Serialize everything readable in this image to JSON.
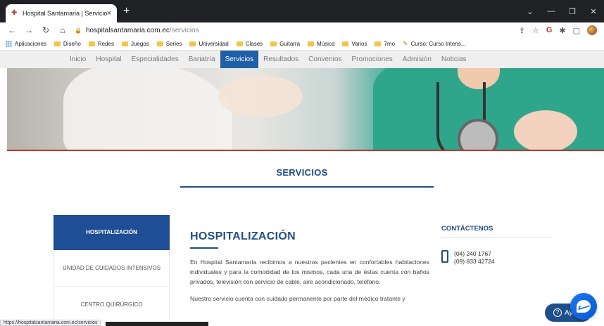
{
  "browser": {
    "tab_title": "Hospital Santamaria | Servicios",
    "tab_close": "×",
    "new_tab": "+",
    "url_host": "hospitalsantamaria.com.ec",
    "url_path": "/servicios",
    "window_controls": [
      "⌄",
      "—",
      "❐",
      "✕"
    ],
    "bookmarks": [
      "Aplicaciones",
      "Diseño",
      "Redes",
      "Juegos",
      "Series",
      "Universidad",
      "Clases",
      "Guitarra",
      "Música",
      "Varios",
      "7mo",
      "Curso: Curso Intens..."
    ],
    "status_url": "https://hospitalsantamaria.com.ec/servicios"
  },
  "nav": {
    "items": [
      "Inicio",
      "Hospital",
      "Especialidades",
      "Bariatría",
      "Servicios",
      "Resultados",
      "Convenios",
      "Promociones",
      "Admisión",
      "Noticias"
    ],
    "active": "Servicios"
  },
  "section": {
    "title": "SERVICIOS"
  },
  "sidebar": {
    "items": [
      "HOSPITALIZACIÓN",
      "UNIDAD DE CUIDADOS INTENSIVOS",
      "CENTRO QUIRÚRGICO"
    ]
  },
  "content": {
    "heading": "HOSPITALIZACIÓN",
    "p1": "En Hospital Santamaría recibimos a nuestros pacientes en confortables habitaciones individuales y para la comodidad de los mismos, cada una de éstas cuenta con baños privados, televisión con servicio de cable, aire acondicionado, teléfono.",
    "p2": "Nuestro servicio cuenta con cuidado permanente por parte del médico tratante y"
  },
  "contact": {
    "heading": "CONTÁCTENOS",
    "phone1": "(04) 240 1767",
    "phone2": "(09) 833 42724"
  },
  "widgets": {
    "help_label": "Ay"
  },
  "colors": {
    "brand_blue": "#1f4e8c",
    "nav_active": "#1f5fa8",
    "accent_red": "#c0392b"
  }
}
